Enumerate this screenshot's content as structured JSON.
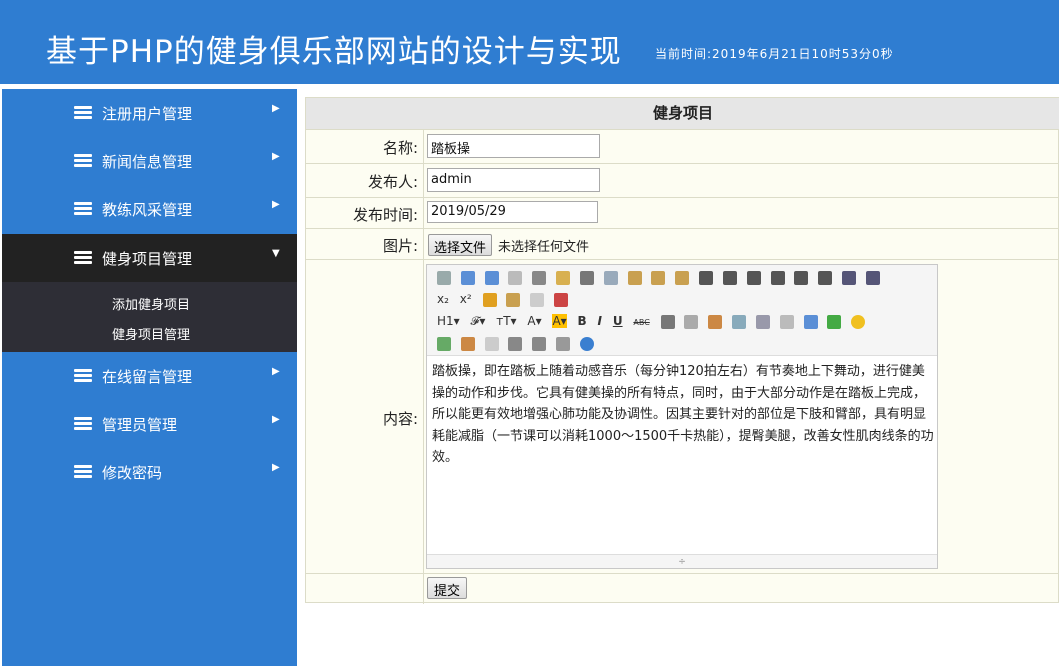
{
  "header": {
    "title": "基于PHP的健身俱乐部网站的设计与实现",
    "time": "当前时间:2019年6月21日10时53分0秒"
  },
  "sidebar": {
    "items": [
      {
        "label": "注册用户管理",
        "arrow": "▶"
      },
      {
        "label": "新闻信息管理",
        "arrow": "▶"
      },
      {
        "label": "教练风采管理",
        "arrow": "▶"
      },
      {
        "label": "健身项目管理",
        "arrow": "▼"
      },
      {
        "label": "在线留言管理",
        "arrow": "▶"
      },
      {
        "label": "管理员管理",
        "arrow": "▶"
      },
      {
        "label": "修改密码",
        "arrow": "▶"
      }
    ],
    "submenu": [
      "添加健身项目",
      "健身项目管理"
    ]
  },
  "form": {
    "heading": "健身项目",
    "name_label": "名称:",
    "name_value": "踏板操",
    "publisher_label": "发布人:",
    "publisher_value": "admin",
    "date_label": "发布时间:",
    "date_value": "2019/05/29",
    "image_label": "图片:",
    "file_button": "选择文件",
    "file_status": "未选择任何文件",
    "content_label": "内容:",
    "content_text": "踏板操，即在踏板上随着动感音乐（每分钟120拍左右）有节奏地上下舞动，进行健美操的动作和步伐。它具有健美操的所有特点，同时，由于大部分动作是在踏板上完成，所以能更有效地增强心肺功能及协调性。因其主要针对的部位是下肢和臂部，具有明显耗能减脂（一节课可以消耗1000～1500千卡热能），提臀美腿，改善女性肌肉线条的功效。",
    "submit_label": "提交"
  },
  "editor_toolbar": {
    "row3": [
      "H1▾",
      "𝓕▾",
      "тT▾",
      "A▾",
      "A▾",
      "B",
      "I",
      "U",
      "ABC"
    ],
    "row2": [
      "x₂",
      "x²"
    ]
  },
  "colors": {
    "brand": "#2f7dd1",
    "active_menu": "#222222",
    "submenu_bg": "#2e2e36",
    "panel_bg": "#fdfdf2"
  }
}
